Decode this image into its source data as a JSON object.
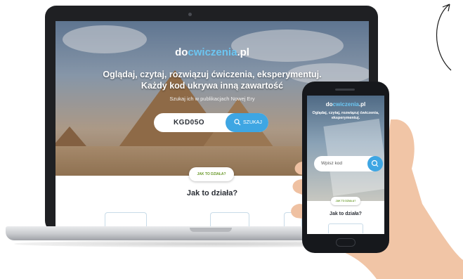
{
  "desktop": {
    "logo_prefix": "do",
    "logo_accent": "cwiczenia",
    "logo_suffix": ".pl",
    "tagline_line1": "Oglądaj, czytaj, rozwiązuj ćwiczenia, eksperymentuj.",
    "tagline_line2": "Każdy kod ukrywa inną zawartość",
    "subline": "Szukaj ich w publikacjach Nowej Ery",
    "search_value": "KGD05O",
    "search_button": "SZUKAJ",
    "how_badge": "JAK TO DZIAŁA?",
    "how_title": "Jak to działa?"
  },
  "mobile": {
    "logo_prefix": "do",
    "logo_accent": "cwiczenia",
    "logo_suffix": ".pl",
    "tagline": "Oglądaj, czytaj, rozwiązuj ćwiczenia, eksperymentuj.",
    "search_placeholder": "Wpisz kod",
    "how_badge": "JAK TO DZIAŁA?",
    "how_title": "Jak to działa?"
  },
  "colors": {
    "accent": "#3ea6e3",
    "logo_accent": "#6cc6f2",
    "badge_text": "#6b9a2c",
    "device_frame": "#1f2023"
  },
  "icons": [
    "search-icon",
    "arrow-icon",
    "camera-icon"
  ]
}
